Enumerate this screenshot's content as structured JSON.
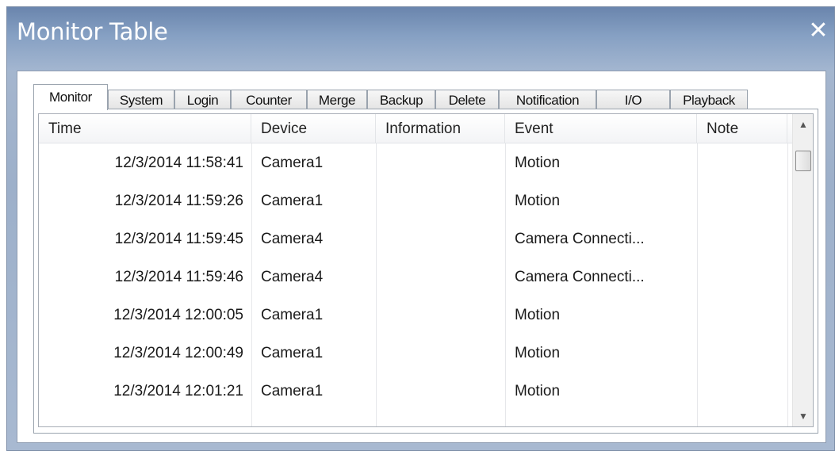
{
  "window": {
    "title": "Monitor Table",
    "close_label": "✕"
  },
  "tabs": [
    {
      "label": "Monitor",
      "active": true
    },
    {
      "label": "System",
      "active": false
    },
    {
      "label": "Login",
      "active": false
    },
    {
      "label": "Counter",
      "active": false
    },
    {
      "label": "Merge",
      "active": false
    },
    {
      "label": "Backup",
      "active": false
    },
    {
      "label": "Delete",
      "active": false
    },
    {
      "label": "Notification",
      "active": false
    },
    {
      "label": "I/O",
      "active": false
    },
    {
      "label": "Playback",
      "active": false
    }
  ],
  "table": {
    "columns": [
      "Time",
      "Device",
      "Information",
      "Event",
      "Note"
    ],
    "rows": [
      {
        "time": "12/3/2014 11:58:41",
        "device": "Camera1",
        "information": "",
        "event": "Motion",
        "note": ""
      },
      {
        "time": "12/3/2014 11:59:26",
        "device": "Camera1",
        "information": "",
        "event": "Motion",
        "note": ""
      },
      {
        "time": "12/3/2014 11:59:45",
        "device": "Camera4",
        "information": "",
        "event": "Camera Connecti...",
        "note": ""
      },
      {
        "time": "12/3/2014 11:59:46",
        "device": "Camera4",
        "information": "",
        "event": "Camera Connecti...",
        "note": ""
      },
      {
        "time": "12/3/2014 12:00:05",
        "device": "Camera1",
        "information": "",
        "event": "Motion",
        "note": ""
      },
      {
        "time": "12/3/2014 12:00:49",
        "device": "Camera1",
        "information": "",
        "event": "Motion",
        "note": ""
      },
      {
        "time": "12/3/2014 12:01:21",
        "device": "Camera1",
        "information": "",
        "event": "Motion",
        "note": ""
      }
    ]
  },
  "scrollbar": {
    "up_icon": "▲",
    "down_icon": "▼"
  },
  "colors": {
    "title_bar": "#6a85ad",
    "frame": "#a9b9d0"
  }
}
